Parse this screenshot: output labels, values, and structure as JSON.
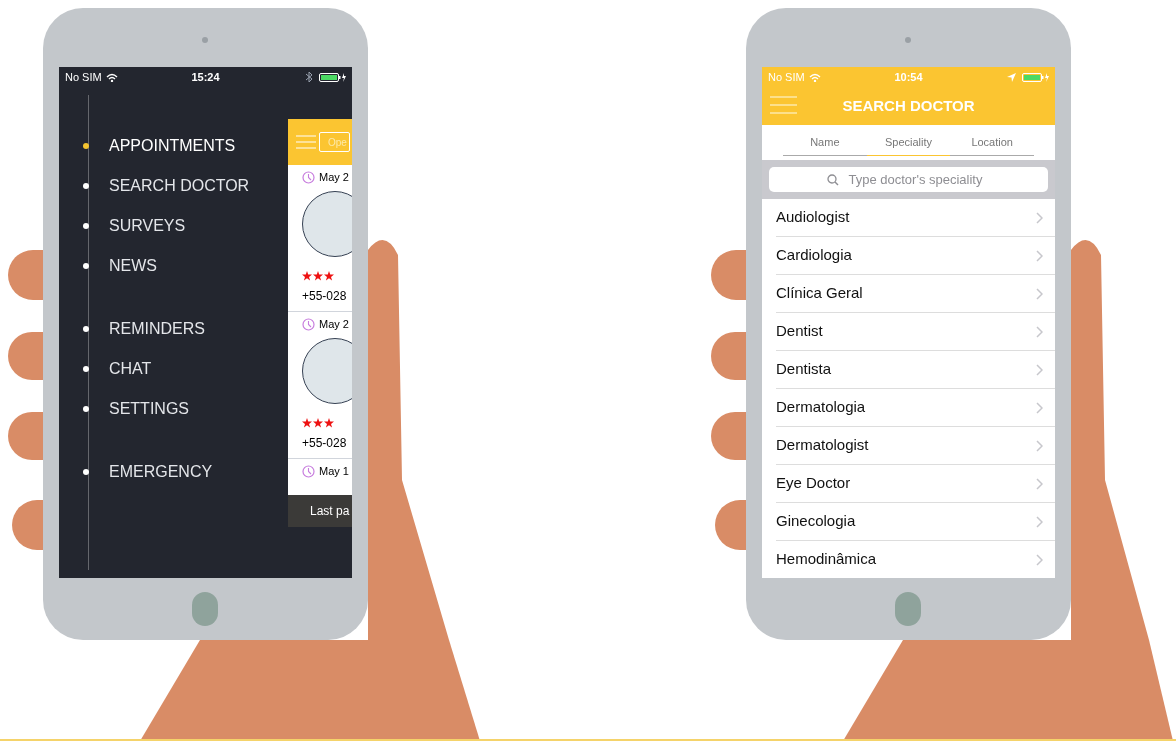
{
  "left_phone": {
    "status_bar": {
      "carrier": "No SIM",
      "time": "15:24"
    },
    "menu_sections": [
      {
        "items": [
          {
            "label": "APPOINTMENTS",
            "selected": true
          },
          {
            "label": "SEARCH DOCTOR",
            "selected": false
          },
          {
            "label": "SURVEYS",
            "selected": false
          },
          {
            "label": "NEWS",
            "selected": false
          }
        ]
      },
      {
        "items": [
          {
            "label": "REMINDERS",
            "selected": false
          },
          {
            "label": "CHAT",
            "selected": false
          },
          {
            "label": "SETTINGS",
            "selected": false
          }
        ]
      },
      {
        "items": [
          {
            "label": "EMERGENCY",
            "selected": false
          }
        ]
      }
    ],
    "appointments_panel": {
      "button": "Ope",
      "appointments": [
        {
          "date": "May 2",
          "stars": 3,
          "phone": "+55-028"
        },
        {
          "date": "May 2",
          "stars": 3,
          "phone": "+55-028"
        },
        {
          "date": "May 1"
        }
      ],
      "footer": "Last pa"
    }
  },
  "right_phone": {
    "status_bar": {
      "carrier": "No SIM",
      "time": "10:54"
    },
    "title": "SEARCH DOCTOR",
    "tabs": [
      {
        "label": "Name",
        "selected": false
      },
      {
        "label": "Speciality",
        "selected": true
      },
      {
        "label": "Location",
        "selected": false
      }
    ],
    "search": {
      "placeholder": "Type doctor's speciality"
    },
    "specialities": [
      "Audiologist",
      "Cardiologia",
      "Clínica Geral",
      "Dentist",
      "Dentista",
      "Dermatologia",
      "Dermatologist",
      "Eye Doctor",
      "Ginecologia",
      "Hemodinâmica"
    ]
  }
}
